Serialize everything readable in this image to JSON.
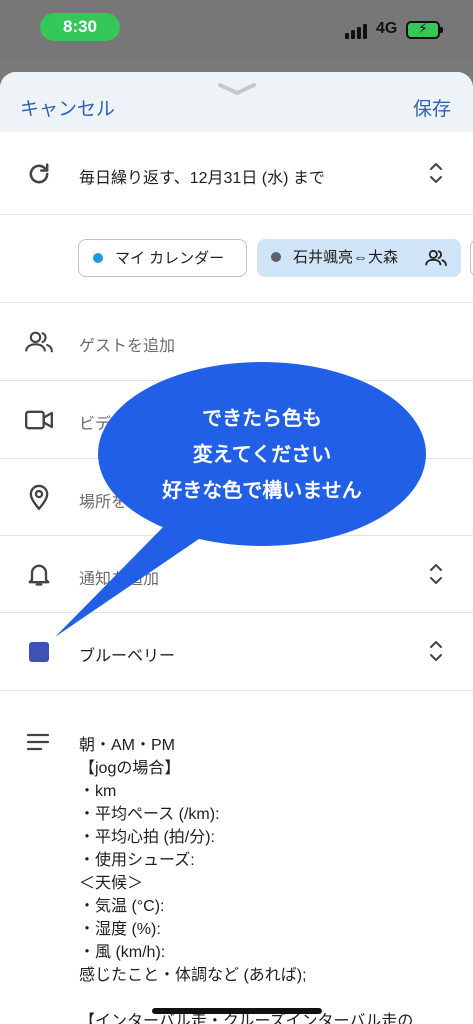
{
  "status": {
    "time": "8:30",
    "network": "4G"
  },
  "header": {
    "cancel_label": "キャンセル",
    "save_label": "保存"
  },
  "repeat": {
    "label": "毎日繰り返す、12月31日 (水) まで"
  },
  "calendars": {
    "items": [
      {
        "label": "マイ カレンダー",
        "dot_color": "#1a9be6"
      },
      {
        "label": "石井颯亮⇔大森",
        "dot_color": "#5f6368"
      }
    ]
  },
  "guests": {
    "placeholder": "ゲストを追加"
  },
  "video": {
    "label": "ビデ"
  },
  "location": {
    "label": "場所を"
  },
  "notification": {
    "label": "通知を追加"
  },
  "color": {
    "label": "ブルーベリー",
    "swatch": "#3f51b5"
  },
  "description": {
    "lines": [
      "朝・AM・PM",
      "【jogの場合】",
      "・km",
      "・平均ペース (/km):",
      "・平均心拍 (拍/分):",
      "・使用シューズ:",
      "＜天候＞",
      "・気温 (°C):",
      "・湿度 (%):",
      "・風 (km/h):",
      "感じたこと・体調など (あれば);",
      "",
      "【インターバル走・クルーズインターバル走の"
    ]
  },
  "annotation": {
    "lines": [
      "できたら色も",
      "変えてください",
      "好きな色で構いません"
    ],
    "color": "#2160e6"
  }
}
